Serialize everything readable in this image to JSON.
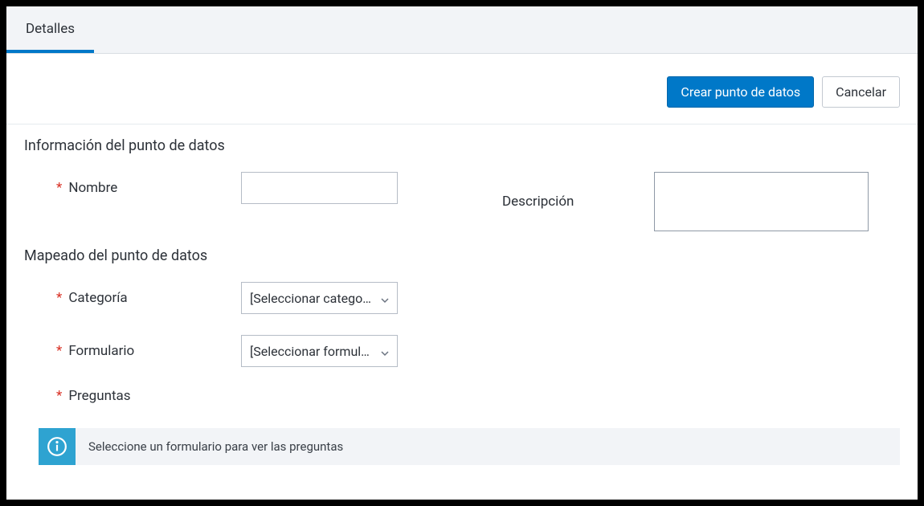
{
  "tabs": {
    "details": "Detalles"
  },
  "actions": {
    "create_label": "Crear punto de datos",
    "cancel_label": "Cancelar"
  },
  "sections": {
    "info_title": "Información del punto de datos",
    "mapping_title": "Mapeado del punto de datos"
  },
  "fields": {
    "name_label": "Nombre",
    "name_value": "",
    "description_label": "Descripción",
    "description_value": "",
    "category_label": "Categoría",
    "category_placeholder": "[Seleccionar categoría]",
    "form_label": "Formulario",
    "form_placeholder": "[Seleccionar formulario]",
    "questions_label": "Preguntas"
  },
  "banner": {
    "message": "Seleccione un formulario para ver las preguntas"
  },
  "symbols": {
    "required": "*"
  }
}
